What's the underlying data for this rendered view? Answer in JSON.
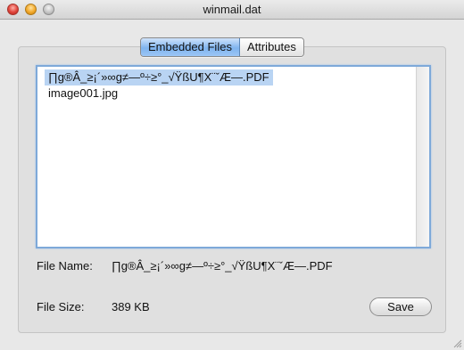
{
  "window": {
    "title": "winmail.dat"
  },
  "tabs": [
    {
      "label": "Embedded Files",
      "active": true
    },
    {
      "label": "Attributes",
      "active": false
    }
  ],
  "files": [
    {
      "name": "∏g®Â_≥¡´»∞g≠—º÷≥°_√ŸßU¶X¨ˇÆ—.PDF",
      "selected": true
    },
    {
      "name": "image001.jpg",
      "selected": false
    }
  ],
  "details": {
    "file_name_label": "File Name:",
    "file_name_value": "∏g®Â_≥¡´»∞g≠—º÷≥°_√ŸßU¶X¨ˇÆ—.PDF",
    "file_size_label": "File Size:",
    "file_size_value": "389 KB"
  },
  "actions": {
    "save_label": "Save"
  },
  "colors": {
    "selection": "#b9d4f3",
    "focus_ring": "#7ea9d9",
    "active_tab": "#7fb4ef"
  }
}
